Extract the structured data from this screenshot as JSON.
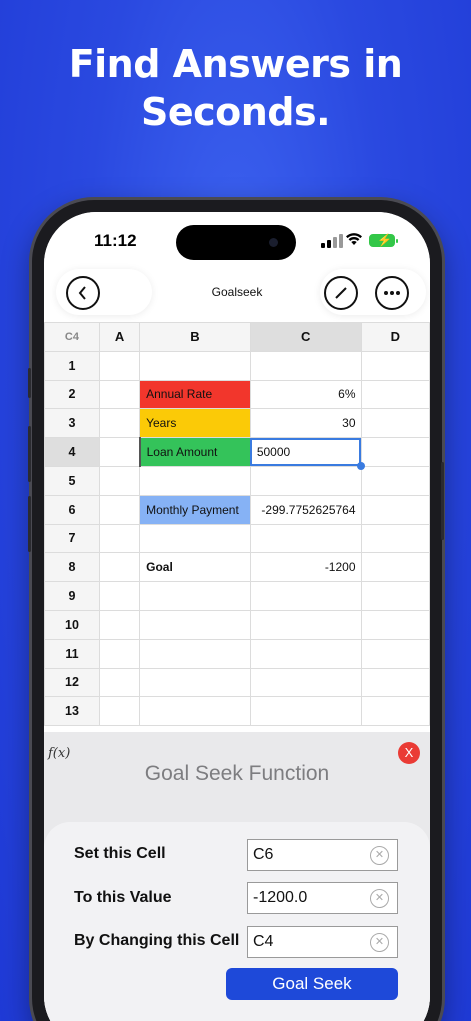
{
  "headline": "Find Answers in Seconds.",
  "status": {
    "time": "11:12"
  },
  "nav": {
    "title": "Goalseek"
  },
  "sheet": {
    "name_box": "C4",
    "columns": [
      "A",
      "B",
      "C",
      "D"
    ],
    "rows": [
      {
        "n": "1",
        "b": "",
        "c": "",
        "b_color": ""
      },
      {
        "n": "2",
        "b": "Annual Rate",
        "c": "6%",
        "b_color": "#f2362c"
      },
      {
        "n": "3",
        "b": "Years",
        "c": "30",
        "b_color": "#fbca07"
      },
      {
        "n": "4",
        "b": "Loan Amount",
        "c": "50000",
        "b_color": "#34c35a"
      },
      {
        "n": "5",
        "b": "",
        "c": "",
        "b_color": ""
      },
      {
        "n": "6",
        "b": "Monthly Payment",
        "c": "-299.7752625764",
        "b_color": "#86b2f5"
      },
      {
        "n": "7",
        "b": "",
        "c": "",
        "b_color": ""
      },
      {
        "n": "8",
        "b": "Goal",
        "c": "-1200",
        "b_color": ""
      },
      {
        "n": "9",
        "b": "",
        "c": "",
        "b_color": ""
      },
      {
        "n": "10",
        "b": "",
        "c": "",
        "b_color": ""
      },
      {
        "n": "11",
        "b": "",
        "c": "",
        "b_color": ""
      },
      {
        "n": "12",
        "b": "",
        "c": "",
        "b_color": ""
      },
      {
        "n": "13",
        "b": "",
        "c": "",
        "b_color": ""
      }
    ]
  },
  "fx": {
    "icon": "f(x)",
    "close": "X",
    "title": "Goal Seek Function",
    "set_cell_label": "Set this Cell",
    "set_cell_value": "C6",
    "to_value_label": "To this Value",
    "to_value_value": "-1200.0",
    "changing_label": "By Changing this Cell",
    "changing_value": "C4",
    "button": "Goal Seek"
  },
  "colors": {
    "accent": "#1e49d9",
    "background": "#2a49e0",
    "close": "#ea3b35"
  }
}
